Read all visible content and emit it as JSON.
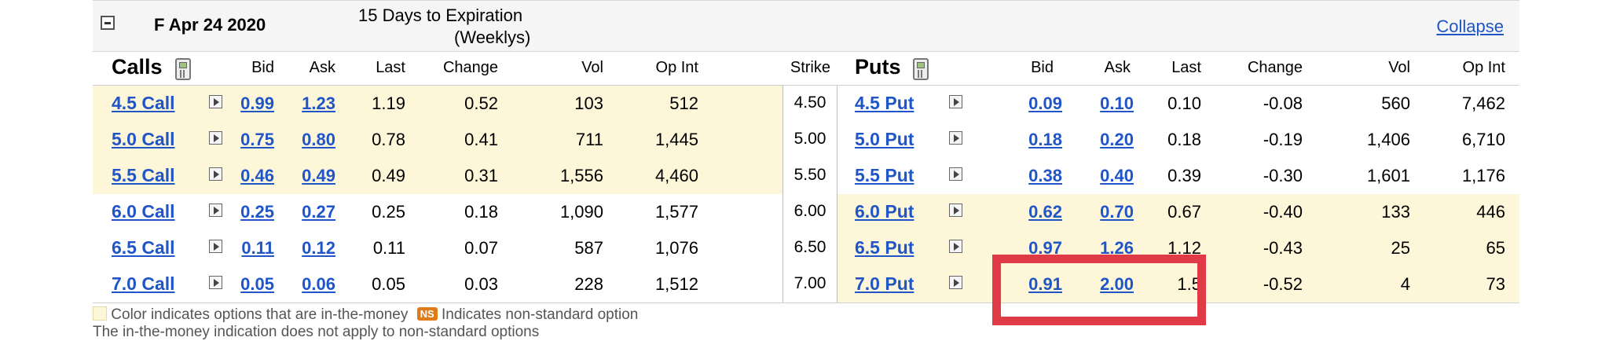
{
  "header": {
    "expiration_date": "F Apr 24 2020",
    "days_line1": "15 Days to Expiration",
    "days_line2": "(Weeklys)",
    "collapse_label": "Collapse",
    "toggle_symbol": "minus"
  },
  "columns": {
    "calls_title": "Calls",
    "puts_title": "Puts",
    "bid": "Bid",
    "ask": "Ask",
    "last": "Last",
    "change": "Change",
    "vol": "Vol",
    "op_int": "Op Int",
    "strike": "Strike"
  },
  "rows": [
    {
      "call_name": "4.5 Call",
      "call_bid": "0.99",
      "call_ask": "1.23",
      "call_last": "1.19",
      "call_change": "0.52",
      "call_vol": "103",
      "call_opint": "512",
      "strike": "4.50",
      "put_name": "4.5 Put",
      "put_bid": "0.09",
      "put_ask": "0.10",
      "put_last": "0.10",
      "put_change": "-0.08",
      "put_vol": "560",
      "put_opint": "7,462",
      "call_itm": true,
      "put_itm": false
    },
    {
      "call_name": "5.0 Call",
      "call_bid": "0.75",
      "call_ask": "0.80",
      "call_last": "0.78",
      "call_change": "0.41",
      "call_vol": "711",
      "call_opint": "1,445",
      "strike": "5.00",
      "put_name": "5.0 Put",
      "put_bid": "0.18",
      "put_ask": "0.20",
      "put_last": "0.18",
      "put_change": "-0.19",
      "put_vol": "1,406",
      "put_opint": "6,710",
      "call_itm": true,
      "put_itm": false
    },
    {
      "call_name": "5.5 Call",
      "call_bid": "0.46",
      "call_ask": "0.49",
      "call_last": "0.49",
      "call_change": "0.31",
      "call_vol": "1,556",
      "call_opint": "4,460",
      "strike": "5.50",
      "put_name": "5.5 Put",
      "put_bid": "0.38",
      "put_ask": "0.40",
      "put_last": "0.39",
      "put_change": "-0.30",
      "put_vol": "1,601",
      "put_opint": "1,176",
      "call_itm": true,
      "put_itm": false
    },
    {
      "call_name": "6.0 Call",
      "call_bid": "0.25",
      "call_ask": "0.27",
      "call_last": "0.25",
      "call_change": "0.18",
      "call_vol": "1,090",
      "call_opint": "1,577",
      "strike": "6.00",
      "put_name": "6.0 Put",
      "put_bid": "0.62",
      "put_ask": "0.70",
      "put_last": "0.67",
      "put_change": "-0.40",
      "put_vol": "133",
      "put_opint": "446",
      "call_itm": false,
      "put_itm": true
    },
    {
      "call_name": "6.5 Call",
      "call_bid": "0.11",
      "call_ask": "0.12",
      "call_last": "0.11",
      "call_change": "0.07",
      "call_vol": "587",
      "call_opint": "1,076",
      "strike": "6.50",
      "put_name": "6.5 Put",
      "put_bid": "0.97",
      "put_ask": "1.26",
      "put_last": "1.12",
      "put_change": "-0.43",
      "put_vol": "25",
      "put_opint": "65",
      "call_itm": false,
      "put_itm": true
    },
    {
      "call_name": "7.0 Call",
      "call_bid": "0.05",
      "call_ask": "0.06",
      "call_last": "0.05",
      "call_change": "0.03",
      "call_vol": "228",
      "call_opint": "1,512",
      "strike": "7.00",
      "put_name": "7.0 Put",
      "put_bid": "0.91",
      "put_ask": "2.00",
      "put_last": "1.5",
      "put_change": "-0.52",
      "put_vol": "4",
      "put_opint": "73",
      "call_itm": false,
      "put_itm": true
    }
  ],
  "footer": {
    "legend_itm": "Color indicates options that are in-the-money",
    "ns_badge": "NS",
    "legend_ns": "Indicates non-standard option",
    "footnote": "The in-the-money indication does not apply to non-standard options"
  },
  "colors": {
    "in_the_money": "#fdf6d8",
    "link": "#1f55c6",
    "highlight_box": "#e03a47"
  }
}
